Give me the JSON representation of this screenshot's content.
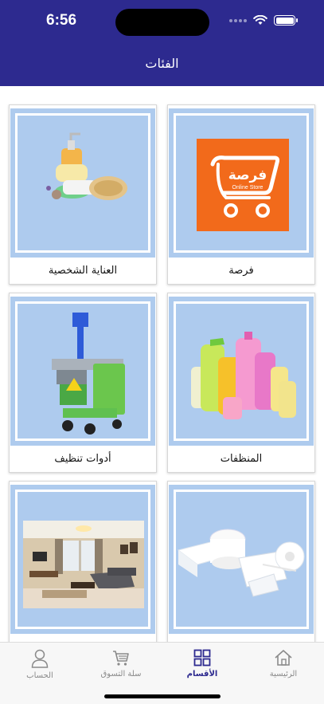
{
  "status_bar": {
    "time": "6:56"
  },
  "header": {
    "title": "الفئات"
  },
  "categories": [
    {
      "label": "فرصة",
      "image": "forsa-online-store-logo"
    },
    {
      "label": "العناية الشخصية",
      "image": "soap-and-sponge-photo"
    },
    {
      "label": "المنظفات",
      "image": "detergent-bottles-photo"
    },
    {
      "label": "أدوات تنظيف",
      "image": "cleaning-cart-photo"
    },
    {
      "label": "",
      "image": "tissue-and-paper-towels-photo"
    },
    {
      "label": "",
      "image": "living-room-photo"
    }
  ],
  "logo": {
    "brand_text": "فرصة",
    "sub_text": "Online Store",
    "color": "#f26a1b"
  },
  "tabbar": {
    "tabs": [
      {
        "label": "الرئيسية",
        "icon": "home-icon"
      },
      {
        "label": "الأقسام",
        "icon": "grid-icon",
        "active": true
      },
      {
        "label": "سلة التسوق",
        "icon": "cart-icon"
      },
      {
        "label": "الحساب",
        "icon": "person-icon"
      }
    ]
  },
  "colors": {
    "header": "#2d2a8f",
    "card_bg": "#aecbee",
    "accent": "#2d2a8f"
  }
}
